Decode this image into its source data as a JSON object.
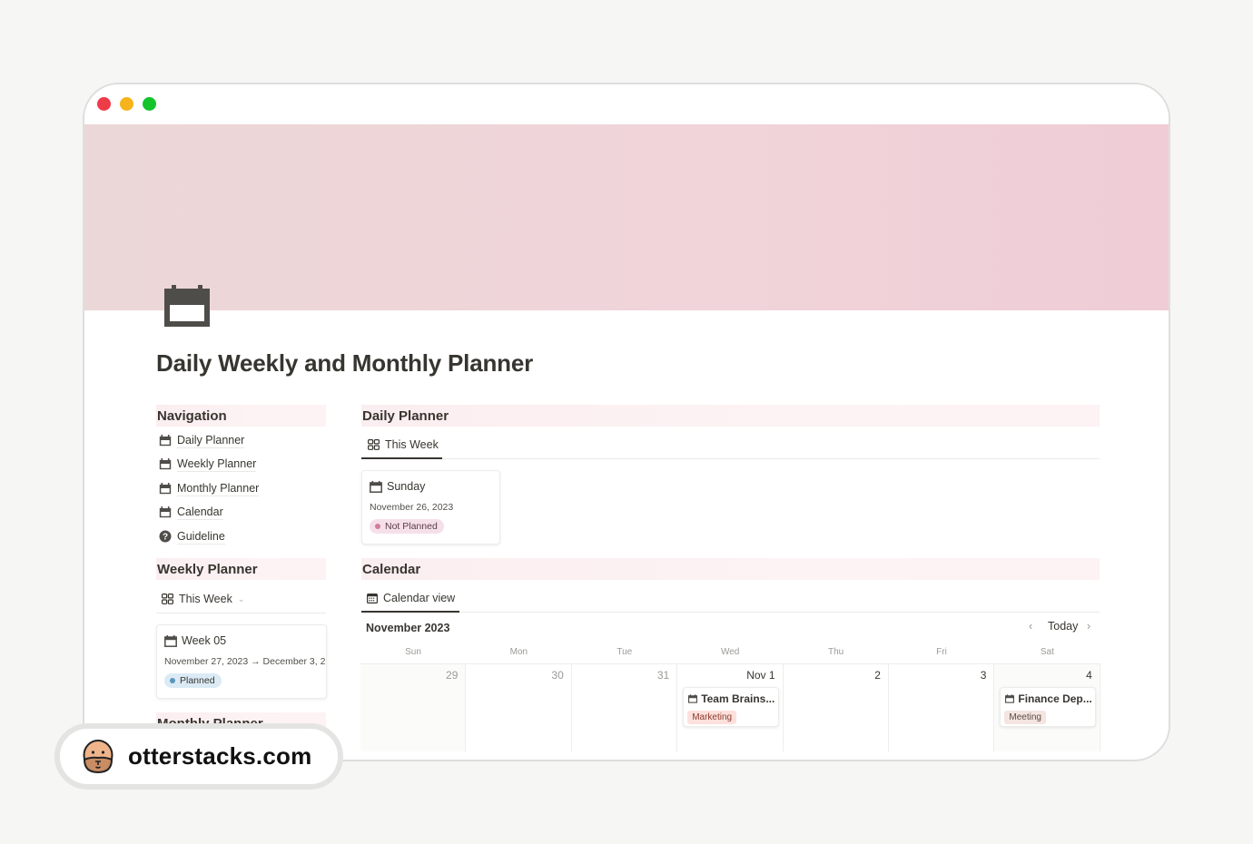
{
  "window": {
    "traffic_lights": [
      "close",
      "minimize",
      "maximize"
    ]
  },
  "page": {
    "icon": "calendar-icon",
    "title": "Daily Weekly and Monthly Planner",
    "cover_color": "#efd4d9"
  },
  "navigation": {
    "heading": "Navigation",
    "items": [
      {
        "label": "Daily Planner",
        "icon": "calendar-icon"
      },
      {
        "label": "Weekly Planner",
        "icon": "calendar-icon"
      },
      {
        "label": "Monthly Planner",
        "icon": "calendar-icon"
      },
      {
        "label": "Calendar",
        "icon": "calendar-icon"
      },
      {
        "label": "Guideline",
        "icon": "question-circle-icon"
      }
    ]
  },
  "weekly_planner": {
    "heading": "Weekly Planner",
    "view_tab": {
      "label": "This Week",
      "icon": "gallery-icon",
      "has_dropdown": true
    },
    "card": {
      "title": "Week 05",
      "date_range": "November 27, 2023 → December 3, 2",
      "status": "Planned",
      "status_bg": "#dbeaf5",
      "status_dot": "#5b97bd",
      "status_text": "#37352f"
    }
  },
  "monthly_planner": {
    "heading": "Monthly Planner"
  },
  "daily_planner": {
    "heading": "Daily Planner",
    "view_tab": {
      "label": "This Week",
      "icon": "gallery-icon"
    },
    "card": {
      "title": "Sunday",
      "date": "November 26, 2023",
      "status": "Not Planned",
      "status_bg": "#f5e0e9",
      "status_dot": "#d17c9c",
      "status_text": "#5c3b47"
    }
  },
  "calendar": {
    "heading": "Calendar",
    "view_tab": {
      "label": "Calendar view",
      "icon": "calendar-view-icon"
    },
    "month": "November 2023",
    "today_label": "Today",
    "weekdays": [
      "Sun",
      "Mon",
      "Tue",
      "Wed",
      "Thu",
      "Fri",
      "Sat"
    ],
    "days": [
      {
        "label": "29",
        "current_month": false
      },
      {
        "label": "30",
        "current_month": false
      },
      {
        "label": "31",
        "current_month": false
      },
      {
        "label": "Nov 1",
        "current_month": true
      },
      {
        "label": "2",
        "current_month": true
      },
      {
        "label": "3",
        "current_month": true
      },
      {
        "label": "4",
        "current_month": true
      }
    ],
    "events": [
      {
        "day_index": 3,
        "title": "Team Brains...",
        "tag": "Marketing",
        "tag_bg": "#fde0dc",
        "tag_color": "#8a3c2d"
      },
      {
        "day_index": 6,
        "title": "Finance Dep...",
        "tag": "Meeting",
        "tag_bg": "#f4e5e0",
        "tag_color": "#5c4a44"
      }
    ]
  },
  "watermark": {
    "text": "otterstacks.com",
    "icon": "otter-logo-icon"
  }
}
